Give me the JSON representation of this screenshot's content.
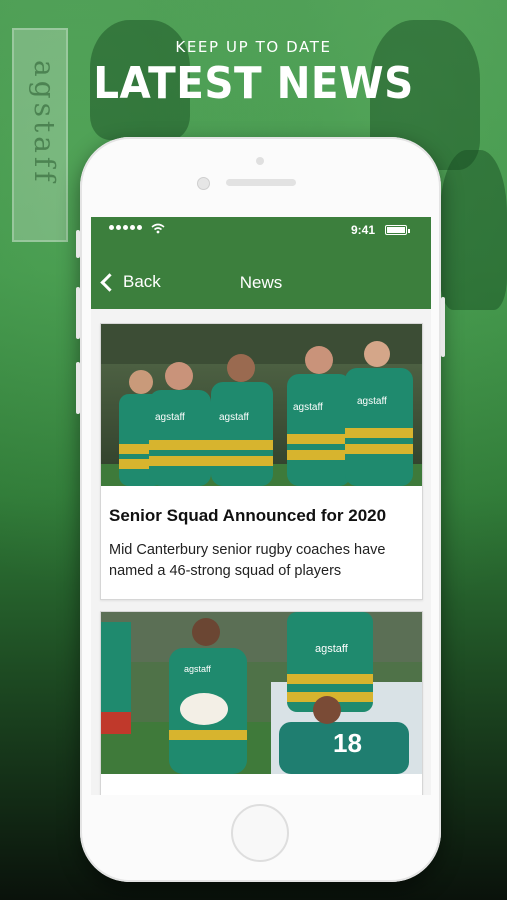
{
  "header": {
    "subtitle": "KEEP UP TO DATE",
    "title": "LATEST NEWS"
  },
  "background": {
    "sign_text": "agstaff"
  },
  "status_bar": {
    "time": "9:41"
  },
  "navbar": {
    "back_label": "Back",
    "title": "News"
  },
  "articles": [
    {
      "title": "Senior Squad Announced for 2020",
      "summary": "Mid Canterbury senior rugby coaches have named a 46-strong squad of players",
      "image_alt": "Team players in green and gold jerseys"
    },
    {
      "title": "",
      "summary": "",
      "image_alt": "Player carrying ball in a match",
      "jersey_number": "18"
    }
  ],
  "colors": {
    "brand_green": "#3c7f3d",
    "jersey_teal": "#1f8a6e",
    "jersey_gold": "#d7b42e"
  }
}
